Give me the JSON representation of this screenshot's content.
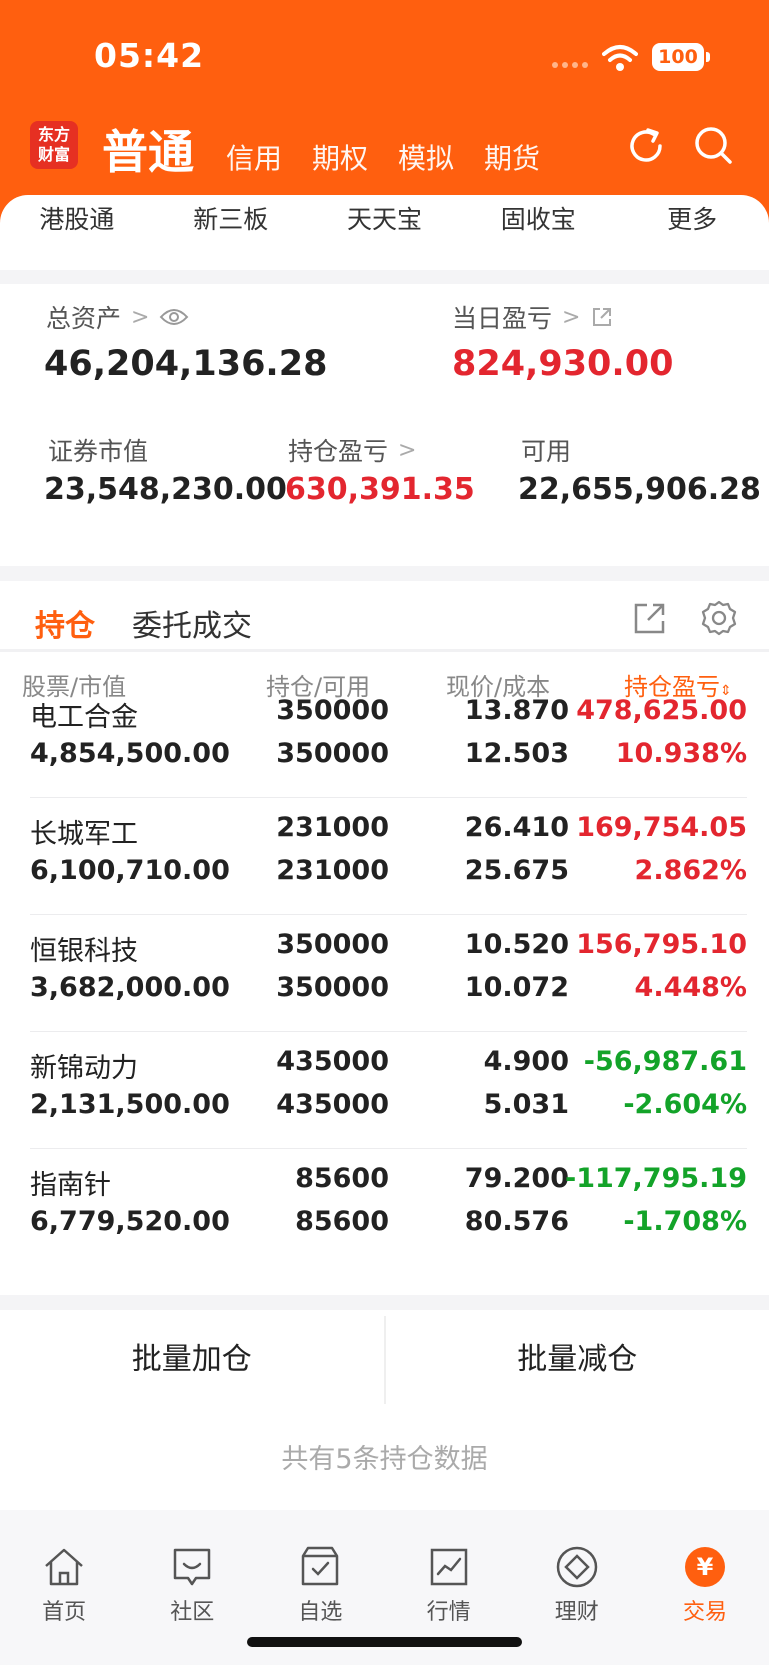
{
  "status_bar": {
    "time": "05:42",
    "battery": "100"
  },
  "header": {
    "logo_text": "东方财富",
    "active_tab": "普通",
    "tabs": [
      "信用",
      "期权",
      "模拟",
      "期货"
    ]
  },
  "subnav": [
    "港股通",
    "新三板",
    "天天宝",
    "固收宝",
    "更多"
  ],
  "assets": {
    "total_label": "总资产",
    "total_value": "46,204,136.28",
    "daily_label": "当日盈亏",
    "daily_value": "824,930.00",
    "market_label": "证券市值",
    "market_value": "23,548,230.00",
    "hold_pl_label": "持仓盈亏",
    "hold_pl_value": "630,391.35",
    "available_label": "可用",
    "available_value": "22,655,906.28"
  },
  "positions": {
    "tab_active": "持仓",
    "tab_other": "委托成交",
    "headers": {
      "stock": "股票/市值",
      "holdings": "持仓/可用",
      "price": "现价/成本",
      "pl": "持仓盈亏"
    },
    "rows": [
      {
        "name": "电工合金",
        "value": "4,854,500.00",
        "hold": "350000",
        "avail": "350000",
        "price": "13.870",
        "cost": "12.503",
        "pl": "478,625.00",
        "pct": "10.938%",
        "dir": "up"
      },
      {
        "name": "长城军工",
        "value": "6,100,710.00",
        "hold": "231000",
        "avail": "231000",
        "price": "26.410",
        "cost": "25.675",
        "pl": "169,754.05",
        "pct": "2.862%",
        "dir": "up"
      },
      {
        "name": "恒银科技",
        "value": "3,682,000.00",
        "hold": "350000",
        "avail": "350000",
        "price": "10.520",
        "cost": "10.072",
        "pl": "156,795.10",
        "pct": "4.448%",
        "dir": "up"
      },
      {
        "name": "新锦动力",
        "value": "2,131,500.00",
        "hold": "435000",
        "avail": "435000",
        "price": "4.900",
        "cost": "5.031",
        "pl": "-56,987.61",
        "pct": "-2.604%",
        "dir": "down"
      },
      {
        "name": "指南针",
        "value": "6,779,520.00",
        "hold": "85600",
        "avail": "85600",
        "price": "79.200",
        "cost": "80.576",
        "pl": "-117,795.19",
        "pct": "-1.708%",
        "dir": "down"
      }
    ]
  },
  "batch": {
    "add": "批量加仓",
    "reduce": "批量减仓"
  },
  "footer_note": "共有5条持仓数据",
  "bottom_nav": [
    {
      "label": "首页",
      "icon": "home-icon"
    },
    {
      "label": "社区",
      "icon": "community-icon"
    },
    {
      "label": "自选",
      "icon": "watchlist-icon"
    },
    {
      "label": "行情",
      "icon": "market-icon"
    },
    {
      "label": "理财",
      "icon": "wealth-icon"
    },
    {
      "label": "交易",
      "icon": "trade-icon",
      "active": true
    }
  ],
  "colors": {
    "brand": "#ff5f0f",
    "up": "#e3262f",
    "down": "#13a329"
  }
}
